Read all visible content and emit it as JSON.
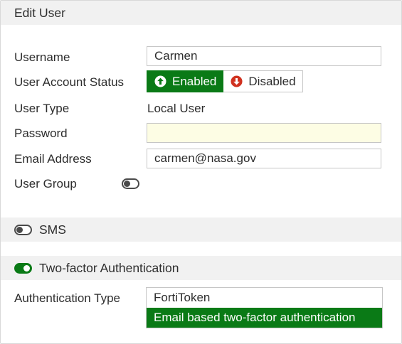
{
  "header": {
    "title": "Edit User"
  },
  "form": {
    "username": {
      "label": "Username",
      "value": "Carmen"
    },
    "status": {
      "label": "User Account Status",
      "enabled": "Enabled",
      "disabled": "Disabled",
      "selected": "Enabled"
    },
    "user_type": {
      "label": "User Type",
      "value": "Local User"
    },
    "password": {
      "label": "Password",
      "value": ""
    },
    "email": {
      "label": "Email Address",
      "value": "carmen@nasa.gov"
    },
    "user_group": {
      "label": "User Group",
      "toggle": "off"
    }
  },
  "sms": {
    "label": "SMS",
    "toggle": "off"
  },
  "two_factor": {
    "label": "Two-factor Authentication",
    "toggle": "on",
    "auth_type": {
      "label": "Authentication Type",
      "options": [
        "FortiToken",
        "Email based two-factor authentication"
      ],
      "selected": "Email based two-factor authentication"
    }
  },
  "colors": {
    "accent": "#0a7a16",
    "disabled_icon": "#d0311f",
    "section_bg": "#f1f1f1",
    "password_bg": "#fdfde4"
  }
}
